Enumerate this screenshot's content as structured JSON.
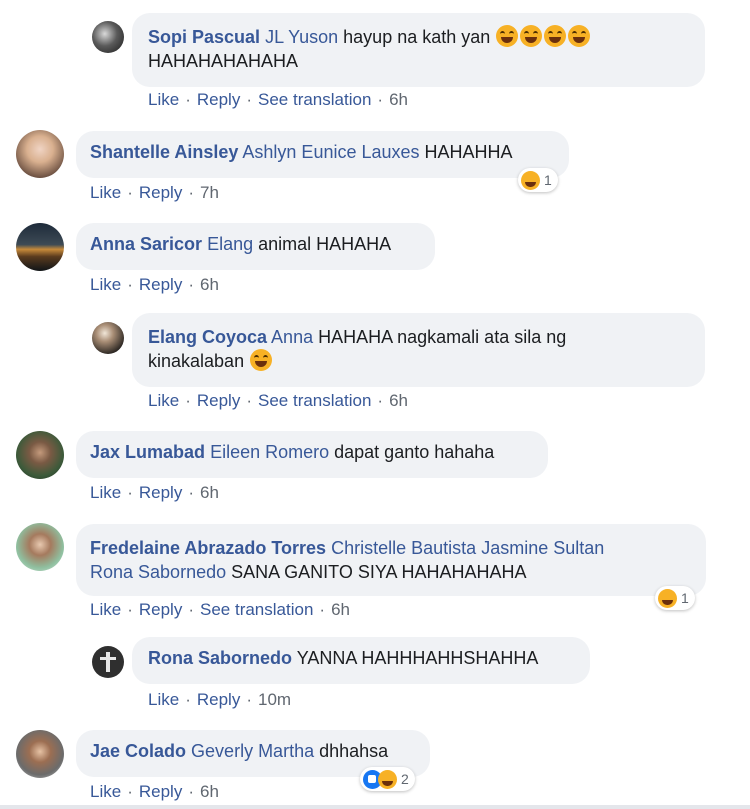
{
  "actions": {
    "like": "Like",
    "reply": "Reply",
    "see_translation": "See translation",
    "dot": "·"
  },
  "comments": [
    {
      "author": "Sopi Pascual",
      "mention": "JL Yuson",
      "text": "hayup na kath yan",
      "text2": "HAHAHAHAHAHA",
      "time": "6h"
    },
    {
      "author": "Shantelle Ainsley",
      "mention": "Ashlyn Eunice Lauxes",
      "text": "HAHAHHA",
      "time": "7h",
      "reaction_count": "1"
    },
    {
      "author": "Anna Saricor",
      "mention": "Elang",
      "text": "animal HAHAHA",
      "time": "6h"
    },
    {
      "author": "Elang Coyoca",
      "mention": "Anna",
      "text": "HAHAHA nagkamali ata sila ng",
      "text2": "kinakalaban",
      "time": "6h"
    },
    {
      "author": "Jax Lumabad",
      "mention": "Eileen Romero",
      "text": "dapat ganto hahaha",
      "time": "6h"
    },
    {
      "author": "Fredelaine Abrazado Torres",
      "mention": "Christelle Bautista",
      "mention2": "Jasmine Sultan",
      "mention3": "Rona Sabornedo",
      "text": "SANA GANITO SIYA HAHAHAHAHA",
      "time": "6h",
      "reaction_count": "1"
    },
    {
      "author": "Rona Sabornedo",
      "text": "YANNA HAHHHAHHSHAHHA",
      "time": "10m"
    },
    {
      "author": "Jae Colado",
      "mention": "Geverly Martha",
      "text": "dhhahsa",
      "time": "6h",
      "reaction_count": "2"
    }
  ]
}
